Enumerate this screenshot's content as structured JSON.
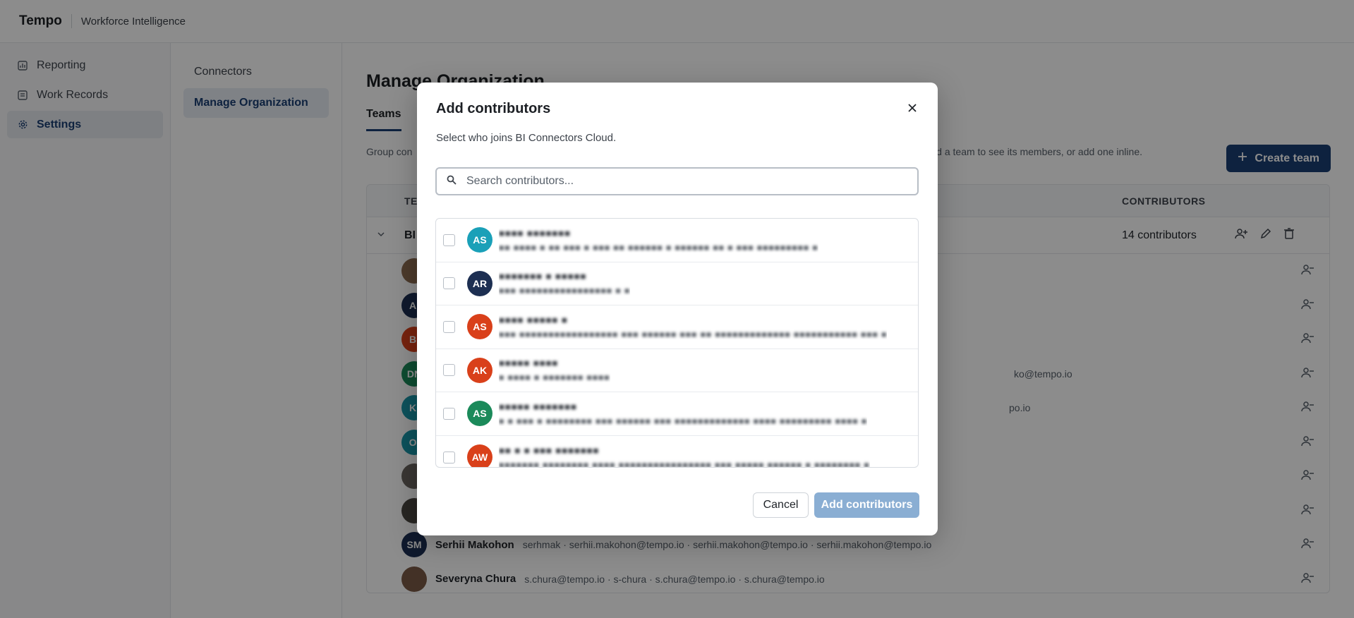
{
  "app": {
    "brand": "Tempo",
    "subtitle": "Workforce Intelligence"
  },
  "leftnav": {
    "items": [
      {
        "label": "Reporting",
        "icon": "chart-icon"
      },
      {
        "label": "Work Records",
        "icon": "clock-icon"
      },
      {
        "label": "Settings",
        "icon": "gear-icon",
        "active": true
      }
    ]
  },
  "subnav": {
    "items": [
      {
        "label": "Connectors"
      },
      {
        "label": "Manage Organization",
        "active": true
      }
    ]
  },
  "main": {
    "title": "Manage Organization",
    "tabs": [
      {
        "label": "Teams"
      }
    ],
    "description_left": "Group con",
    "description_right": "d a team to see its members, or add one inline.",
    "create_button": "Create team",
    "table": {
      "headers": {
        "team": "TE",
        "contributors": "CONTRIBUTORS"
      },
      "team_row": {
        "name": "BI",
        "count": "14 contributors"
      },
      "members": [
        {
          "initials": "",
          "color": "#8a6b4f",
          "name": "",
          "ids": ""
        },
        {
          "initials": "AI",
          "color": "#1d2f52",
          "name": "",
          "ids": ""
        },
        {
          "initials": "BI",
          "color": "#d9401a",
          "name": "",
          "ids": ""
        },
        {
          "initials": "DN",
          "color": "#1b8a5a",
          "name": "",
          "ids": "ko@tempo.io"
        },
        {
          "initials": "KI",
          "color": "#1996a8",
          "name": "",
          "ids": "po.io"
        },
        {
          "initials": "OI",
          "color": "#1996a8",
          "name": "",
          "ids": ""
        },
        {
          "initials": "",
          "color": "#6b6560",
          "name": "",
          "ids": ""
        },
        {
          "initials": "",
          "color": "#4a4540",
          "name": "",
          "ids": ""
        },
        {
          "initials": "SM",
          "color": "#1d2f52",
          "name": "Serhii Makohon",
          "ids": "serhmak · serhii.makohon@tempo.io · serhii.makohon@tempo.io · serhii.makohon@tempo.io"
        },
        {
          "initials": "",
          "color": "#7a5a45",
          "name": "Severyna Chura",
          "ids": "s.chura@tempo.io · s-chura · s.chura@tempo.io · s.chura@tempo.io"
        }
      ]
    }
  },
  "modal": {
    "title": "Add contributors",
    "subtitle": "Select who joins BI Connectors Cloud.",
    "search_placeholder": "Search contributors...",
    "contributors": [
      {
        "initials": "AS",
        "color": "#1aa0b8",
        "name": "■■■■ ■■■■■■■",
        "meta": "■■ ■■■■ ■ ■■ ■■■ ■ ■■■ ■■ ■■■■■■ ■ ■■■■■■ ■■ ■ ■■■ ■■■■■■■■■ ■"
      },
      {
        "initials": "AR",
        "color": "#1d2f52",
        "name": "■■■■■■■ ■ ■■■■■",
        "meta": "■■■ ■■■■■■■■■■■■■■■■ ■ ■"
      },
      {
        "initials": "AS",
        "color": "#d9401a",
        "name": "■■■■ ■■■■■ ■",
        "meta": "■■■ ■■■■■■■■■■■■■■■■■ ■■■ ■■■■■■ ■■■ ■■ ■■■■■■■■■■■■■ ■■■■■■■■■■■ ■■■ ■"
      },
      {
        "initials": "AK",
        "color": "#d9401a",
        "name": "■■■■■ ■■■■",
        "meta": "■ ■■■■ ■ ■■■■■■■ ■■■■"
      },
      {
        "initials": "AS",
        "color": "#1b8a5a",
        "name": "■■■■■ ■■■■■■■",
        "meta": "■ ■ ■■■ ■ ■■■■■■■■ ■■■ ■■■■■■ ■■■ ■■■■■■■■■■■■■ ■■■■ ■■■■■■■■■ ■■■■ ■"
      },
      {
        "initials": "AW",
        "color": "#d9401a",
        "name": "■■ ■ ■ ■■■ ■■■■■■■",
        "meta": "■■■■■■■ ■■■■■■■■ ■■■■ ■■■■■■■■■■■■■■■■ ■■■ ■■■■■ ■■■■■■ ■ ■■■■■■■■ ■"
      }
    ],
    "cancel_label": "Cancel",
    "add_label": "Add contributors"
  }
}
